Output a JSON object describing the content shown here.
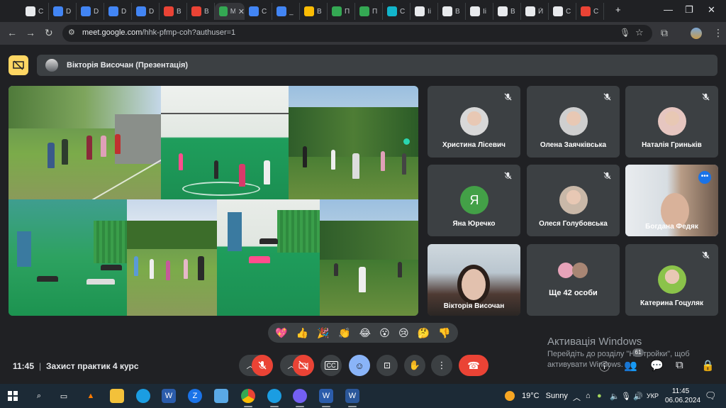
{
  "browser": {
    "tabs": [
      {
        "label": "С",
        "color": "#e8eaed"
      },
      {
        "label": "D",
        "color": "#4285f4"
      },
      {
        "label": "D",
        "color": "#4285f4"
      },
      {
        "label": "D",
        "color": "#4285f4"
      },
      {
        "label": "D",
        "color": "#4285f4"
      },
      {
        "label": "В",
        "color": "#ea4335"
      },
      {
        "label": "В",
        "color": "#ea4335"
      },
      {
        "label": "М",
        "color": "#34a853",
        "active": true
      },
      {
        "label": "С",
        "color": "#4285f4"
      },
      {
        "label": "_",
        "color": "#4285f4"
      },
      {
        "label": "В",
        "color": "#fbbc04"
      },
      {
        "label": "П",
        "color": "#34a853"
      },
      {
        "label": "П",
        "color": "#34a853"
      },
      {
        "label": "С",
        "color": "#12b5cb"
      },
      {
        "label": "Іі",
        "color": "#e8eaed"
      },
      {
        "label": "В",
        "color": "#e8eaed"
      },
      {
        "label": "Іі",
        "color": "#e8eaed"
      },
      {
        "label": "В",
        "color": "#e8eaed"
      },
      {
        "label": "Й",
        "color": "#e8eaed"
      },
      {
        "label": "С",
        "color": "#e8eaed"
      },
      {
        "label": "С",
        "color": "#ea4335"
      }
    ],
    "new_tab": "+",
    "url_domain": "meet.google.com",
    "url_path": "/hhk-pfmp-coh?authuser=1"
  },
  "meet": {
    "presenter_name": "Вікторія Височан (Презентація)",
    "participants": [
      {
        "name": "Христина Лісевич",
        "muted": true,
        "avatar_color": "#d8d8d8"
      },
      {
        "name": "Олена Заячківська",
        "muted": true,
        "avatar_color": "#cfcfcf"
      },
      {
        "name": "Наталія Гриньків",
        "muted": true,
        "avatar_color": "#e6c6c0"
      },
      {
        "name": "Яна Юречко",
        "muted": true,
        "initial": "Я",
        "avatar_color": "#43a047"
      },
      {
        "name": "Олеся Голубовська",
        "muted": true,
        "avatar_color": "#c9b8a8"
      },
      {
        "name": "Богдана Федяк",
        "muted": false,
        "video": true,
        "speaking": true
      },
      {
        "name": "Вікторія Височан",
        "muted": false,
        "video": true
      },
      {
        "name": "Ще 42 особи",
        "muted": false,
        "group": true
      },
      {
        "name": "Катерина Гоцуляк",
        "muted": true,
        "avatar_color": "#8bc34a"
      }
    ],
    "reactions": [
      "💖",
      "👍",
      "🎉",
      "👏",
      "😂",
      "😮",
      "😢",
      "🤔",
      "👎"
    ],
    "meeting_time": "11:45",
    "separator": "|",
    "meeting_title": "Захист практик 4 курс",
    "participant_count": "61",
    "activation": {
      "title": "Активація Windows",
      "line1": "Перейдіть до розділу \"Настройки\", щоб",
      "line2": "активувати Windows."
    }
  },
  "taskbar": {
    "weather_temp": "19°C",
    "weather_desc": "Sunny",
    "lang": "УКР",
    "time": "11:45",
    "date": "06.06.2024"
  },
  "colors": {
    "accent_blue": "#8ab4f8",
    "end_call_red": "#ea4335",
    "present_yellow": "#fdd663"
  }
}
